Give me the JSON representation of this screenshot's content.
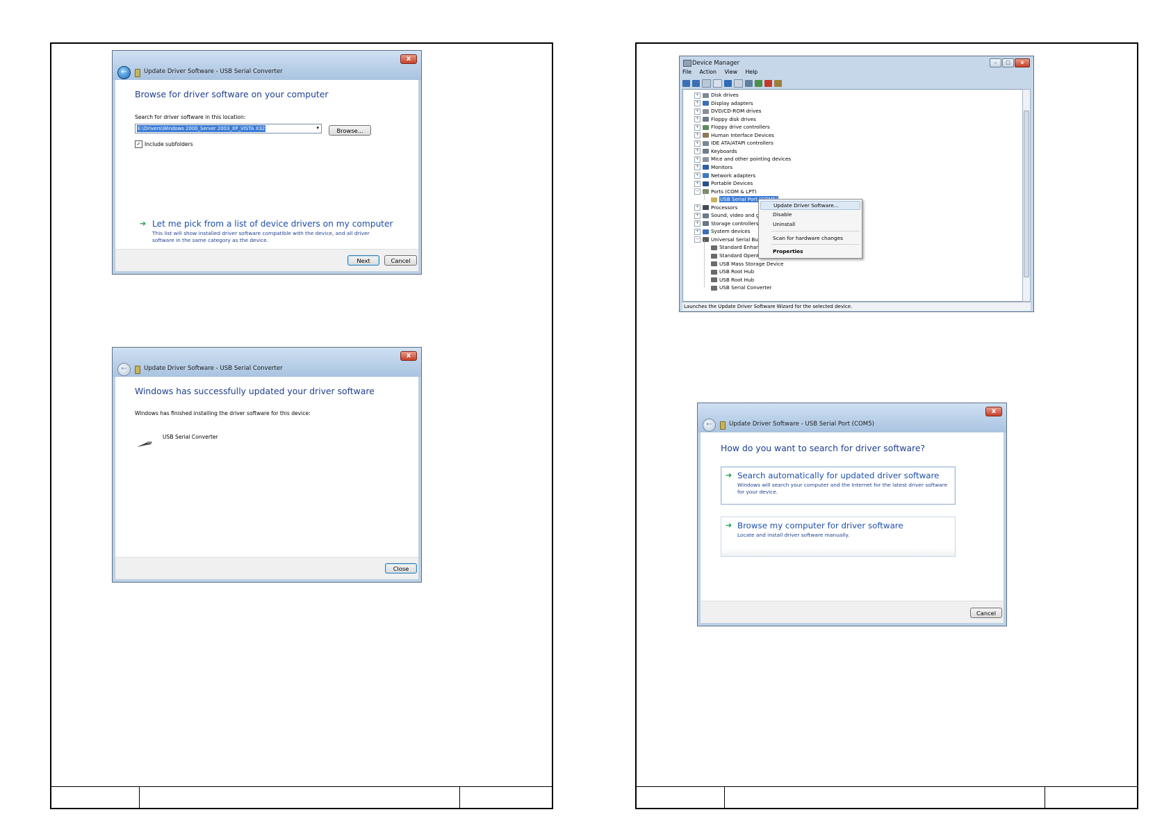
{
  "dialog1": {
    "title": "Update Driver Software - USB Serial Converter",
    "close_glyph": "x",
    "back_glyph": "←",
    "heading": "Browse for driver software on your computer",
    "search_label": "Search for driver software in this location:",
    "path_value": "E:\\Drivers\\Windows 2000_Server 2003_XP_VISTA X32",
    "browse_label": "Browse...",
    "include_subfolders": "Include subfolders",
    "include_subfolders_checked": "✓",
    "pick_link": "Let me pick from a list of device drivers on my computer",
    "pick_desc": "This list will show installed driver software compatible with the device, and all driver software in the same category as the device.",
    "next_label": "Next",
    "cancel_label": "Cancel"
  },
  "dialog2": {
    "title": "Update Driver Software - USB Serial Converter",
    "close_glyph": "x",
    "back_glyph": "←",
    "heading": "Windows has successfully updated your driver software",
    "finished_text": "Windows has finished installing the driver software for this device:",
    "device_name": "USB Serial Converter",
    "close_label": "Close"
  },
  "device_manager": {
    "title": "Device Manager",
    "menus": [
      "File",
      "Action",
      "View",
      "Help"
    ],
    "window_buttons": [
      "–",
      "□",
      "x"
    ],
    "tree": [
      {
        "label": "Disk drives",
        "expand": "+",
        "color": "#7d8b99"
      },
      {
        "label": "Display adapters",
        "expand": "+",
        "color": "#3b6fb6"
      },
      {
        "label": "DVD/CD-ROM drives",
        "expand": "+",
        "color": "#8a8f96"
      },
      {
        "label": "Floppy disk drives",
        "expand": "+",
        "color": "#6d7a88"
      },
      {
        "label": "Floppy drive controllers",
        "expand": "+",
        "color": "#5b8d5b"
      },
      {
        "label": "Human Interface Devices",
        "expand": "+",
        "color": "#8a7a5a"
      },
      {
        "label": "IDE ATA/ATAPI controllers",
        "expand": "+",
        "color": "#7b8794"
      },
      {
        "label": "Keyboards",
        "expand": "+",
        "color": "#6f7d8a"
      },
      {
        "label": "Mice and other pointing devices",
        "expand": "+",
        "color": "#8d95a0"
      },
      {
        "label": "Monitors",
        "expand": "+",
        "color": "#2f5ea8"
      },
      {
        "label": "Network adapters",
        "expand": "+",
        "color": "#3e7ac0"
      },
      {
        "label": "Portable Devices",
        "expand": "+",
        "color": "#2d4f8a"
      },
      {
        "label": "Ports (COM & LPT)",
        "expand": "−",
        "color": "#7a8a6a"
      },
      {
        "label": "USB Serial Port (COM5)",
        "expand": "",
        "color": "#c7b45a",
        "child": true,
        "selected": true
      },
      {
        "label": "Processors",
        "expand": "+",
        "color": "#444b55"
      },
      {
        "label": "Sound, video and game controllers",
        "expand": "+",
        "color": "#6c7a8a"
      },
      {
        "label": "Storage controllers",
        "expand": "+",
        "color": "#6a7886"
      },
      {
        "label": "System devices",
        "expand": "+",
        "color": "#3b6fb6"
      },
      {
        "label": "Universal Serial Bus controllers",
        "expand": "−",
        "color": "#5a5a5a"
      },
      {
        "label": "Standard Enhanced PCI to USB Host Controller",
        "expand": "",
        "color": "#6b6b6b",
        "child": true
      },
      {
        "label": "Standard OpenHCD USB Host Controller",
        "expand": "",
        "color": "#6b6b6b",
        "child": true
      },
      {
        "label": "USB Mass Storage Device",
        "expand": "",
        "color": "#6b6b6b",
        "child": true
      },
      {
        "label": "USB Root Hub",
        "expand": "",
        "color": "#6b6b6b",
        "child": true
      },
      {
        "label": "USB Root Hub",
        "expand": "",
        "color": "#6b6b6b",
        "child": true
      },
      {
        "label": "USB Serial Converter",
        "expand": "",
        "color": "#6b6b6b",
        "child": true
      }
    ],
    "context_menu": {
      "update": "Update Driver Software...",
      "disable": "Disable",
      "uninstall": "Uninstall",
      "scan": "Scan for hardware changes",
      "properties": "Properties"
    },
    "status": "Launches the Update Driver Software Wizard for the selected device."
  },
  "dialog3": {
    "title": "Update Driver Software - USB Serial Port (COM5)",
    "close_glyph": "x",
    "back_glyph": "←",
    "heading": "How do you want to search for driver software?",
    "option1_title": "Search automatically for updated driver software",
    "option1_desc": "Windows will search your computer and the Internet for the latest driver software for your device.",
    "option2_title": "Browse my computer for driver software",
    "option2_desc": "Locate and install driver software manually.",
    "cancel_label": "Cancel"
  }
}
